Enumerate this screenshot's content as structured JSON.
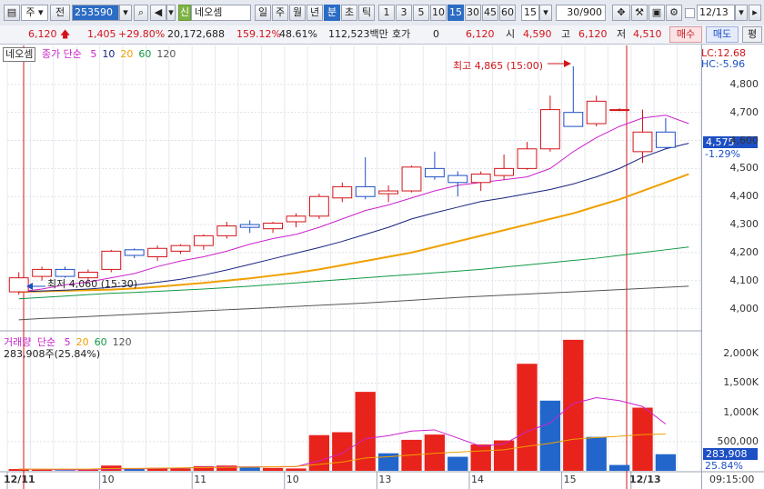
{
  "toolbar": {
    "market": "주",
    "prev_label": "전",
    "code": "253590",
    "badge": "신",
    "stock_name": "네오셈",
    "periods": [
      "일",
      "주",
      "월",
      "년",
      "분",
      "초",
      "틱"
    ],
    "selected_period": "분",
    "intervals": [
      "1",
      "3",
      "5",
      "10",
      "15",
      "30",
      "45",
      "60"
    ],
    "selected_interval": "15",
    "interval_value": "15",
    "count": "30/900",
    "date": "12/13"
  },
  "quote": {
    "price": "6,120",
    "change": "1,405",
    "change_pct": "+29.80%",
    "volume": "20,172,688",
    "volume_ratio": "159.12%",
    "turnover_ratio": "48.61%",
    "amount": "112,523백만",
    "hoga_label": "호가",
    "hoga_value": "0",
    "hoga_price": "6,120",
    "open_label": "시",
    "open": "4,590",
    "high_label": "고",
    "high": "6,120",
    "low_label": "저",
    "low": "4,510",
    "buy": "매수",
    "sell": "매도",
    "eval": "평"
  },
  "price_panel": {
    "stock_tag": "네오셈",
    "ma_label": "종가 단순",
    "ma_periods": [
      "5",
      "10",
      "20",
      "60",
      "120"
    ],
    "ma_colors": [
      "#cc22cc",
      "#1a237e",
      "#f0a000",
      "#119944",
      "#555555"
    ],
    "lc": "LC:12.68",
    "hc": "HC:-5.96",
    "current_price": "4,575",
    "current_pct": "-1.29%",
    "high_note": "최고 4,865 (15:00)",
    "low_note": "최저 4,060 (15:30)"
  },
  "volume_panel": {
    "label": "거래량",
    "ma_label": "단순",
    "ma_periods": [
      "5",
      "20",
      "60",
      "120"
    ],
    "current": "283,908주(25.84%)",
    "current_value": "283,908",
    "current_pct": "25.84%"
  },
  "time_axis": {
    "labels": [
      "12/11",
      "10",
      "11",
      "10",
      "13",
      "14",
      "15",
      "12/13"
    ],
    "time": "09:15:00"
  },
  "chart_data": [
    {
      "type": "candlestick",
      "ylim": [
        3950,
        4900
      ],
      "yticks": [
        "4,000",
        "4,100",
        "4,200",
        "4,300",
        "4,400",
        "4,500",
        "4,600",
        "4,700",
        "4,800"
      ],
      "candles": [
        {
          "o": 4060,
          "h": 4130,
          "l": 4050,
          "c": 4110
        },
        {
          "o": 4115,
          "h": 4150,
          "l": 4100,
          "c": 4140
        },
        {
          "o": 4140,
          "h": 4150,
          "l": 4110,
          "c": 4115
        },
        {
          "o": 4110,
          "h": 4140,
          "l": 4100,
          "c": 4130
        },
        {
          "o": 4140,
          "h": 4210,
          "l": 4130,
          "c": 4205
        },
        {
          "o": 4210,
          "h": 4215,
          "l": 4180,
          "c": 4190
        },
        {
          "o": 4185,
          "h": 4225,
          "l": 4170,
          "c": 4215
        },
        {
          "o": 4205,
          "h": 4230,
          "l": 4195,
          "c": 4225
        },
        {
          "o": 4225,
          "h": 4265,
          "l": 4210,
          "c": 4260
        },
        {
          "o": 4260,
          "h": 4310,
          "l": 4250,
          "c": 4295
        },
        {
          "o": 4300,
          "h": 4315,
          "l": 4270,
          "c": 4290
        },
        {
          "o": 4285,
          "h": 4310,
          "l": 4270,
          "c": 4305
        },
        {
          "o": 4310,
          "h": 4340,
          "l": 4290,
          "c": 4330
        },
        {
          "o": 4330,
          "h": 4410,
          "l": 4320,
          "c": 4400
        },
        {
          "o": 4395,
          "h": 4450,
          "l": 4380,
          "c": 4435
        },
        {
          "o": 4435,
          "h": 4540,
          "l": 4390,
          "c": 4400
        },
        {
          "o": 4410,
          "h": 4440,
          "l": 4380,
          "c": 4420
        },
        {
          "o": 4420,
          "h": 4510,
          "l": 4415,
          "c": 4505
        },
        {
          "o": 4500,
          "h": 4560,
          "l": 4460,
          "c": 4470
        },
        {
          "o": 4475,
          "h": 4490,
          "l": 4400,
          "c": 4450
        },
        {
          "o": 4450,
          "h": 4490,
          "l": 4420,
          "c": 4480
        },
        {
          "o": 4475,
          "h": 4550,
          "l": 4460,
          "c": 4500
        },
        {
          "o": 4500,
          "h": 4595,
          "l": 4495,
          "c": 4570
        },
        {
          "o": 4570,
          "h": 4760,
          "l": 4560,
          "c": 4710
        },
        {
          "o": 4700,
          "h": 4865,
          "l": 4650,
          "c": 4650
        },
        {
          "o": 4660,
          "h": 4760,
          "l": 4650,
          "c": 4740
        },
        {
          "o": 4710,
          "h": 4715,
          "l": 4705,
          "c": 4710
        },
        {
          "o": 4560,
          "h": 4710,
          "l": 4520,
          "c": 4630
        },
        {
          "o": 4630,
          "h": 4680,
          "l": 4570,
          "c": 4575
        }
      ],
      "ma5": [
        4060,
        4070,
        4085,
        4095,
        4110,
        4125,
        4150,
        4170,
        4185,
        4205,
        4230,
        4250,
        4265,
        4290,
        4320,
        4350,
        4370,
        4395,
        4420,
        4440,
        4450,
        4460,
        4470,
        4500,
        4560,
        4610,
        4650,
        4680,
        4690,
        4660
      ],
      "ma10": [
        4060,
        4063,
        4066,
        4070,
        4076,
        4084,
        4094,
        4105,
        4120,
        4138,
        4158,
        4178,
        4198,
        4218,
        4240,
        4265,
        4290,
        4320,
        4342,
        4362,
        4382,
        4395,
        4410,
        4425,
        4445,
        4470,
        4500,
        4540,
        4570,
        4590
      ],
      "ma20": [
        4060,
        4062,
        4064,
        4066,
        4068,
        4072,
        4078,
        4085,
        4092,
        4100,
        4108,
        4118,
        4128,
        4140,
        4155,
        4170,
        4185,
        4200,
        4220,
        4240,
        4260,
        4280,
        4300,
        4320,
        4340,
        4365,
        4390,
        4420,
        4450,
        4480
      ],
      "ma60": [
        4035,
        4040,
        4045,
        4050,
        4055,
        4058,
        4062,
        4066,
        4070,
        4075,
        4080,
        4086,
        4092,
        4098,
        4104,
        4110,
        4116,
        4122,
        4128,
        4134,
        4140,
        4148,
        4156,
        4164,
        4172,
        4180,
        4190,
        4200,
        4210,
        4220
      ],
      "ma120": [
        3960,
        3965,
        3968,
        3972,
        3976,
        3980,
        3984,
        3988,
        3992,
        3996,
        4000,
        4004,
        4008,
        4012,
        4016,
        4020,
        4025,
        4030,
        4035,
        4040,
        4044,
        4048,
        4052,
        4056,
        4060,
        4064,
        4068,
        4072,
        4076,
        4080
      ]
    },
    {
      "type": "bar",
      "ylim": [
        0,
        2300000
      ],
      "yticks": [
        "500,000",
        "1,000K",
        "1,500K",
        "2,000K"
      ],
      "values": [
        30000,
        20000,
        10000,
        15000,
        90000,
        40000,
        50000,
        40000,
        80000,
        90000,
        60000,
        50000,
        40000,
        610000,
        660000,
        1350000,
        300000,
        530000,
        620000,
        240000,
        450000,
        520000,
        1830000,
        1200000,
        2240000,
        580000,
        100000,
        1080000,
        283908
      ],
      "up": [
        1,
        1,
        0,
        1,
        1,
        0,
        1,
        1,
        1,
        1,
        0,
        1,
        1,
        1,
        1,
        1,
        0,
        1,
        1,
        0,
        1,
        1,
        1,
        0,
        1,
        0,
        0,
        1,
        0
      ],
      "ma5": [
        30000,
        25000,
        20000,
        20000,
        33000,
        35000,
        41000,
        47000,
        60000,
        66000,
        68000,
        70000,
        72000,
        170000,
        300000,
        550000,
        600000,
        680000,
        700000,
        560000,
        420000,
        460000,
        670000,
        820000,
        1150000,
        1250000,
        1200000,
        1100000,
        800000
      ],
      "ma20": [
        30000,
        30000,
        30000,
        30000,
        40000,
        40000,
        45000,
        50000,
        55000,
        60000,
        65000,
        70000,
        75000,
        110000,
        150000,
        220000,
        240000,
        270000,
        300000,
        320000,
        340000,
        360000,
        420000,
        470000,
        540000,
        570000,
        590000,
        620000,
        630000
      ]
    }
  ]
}
